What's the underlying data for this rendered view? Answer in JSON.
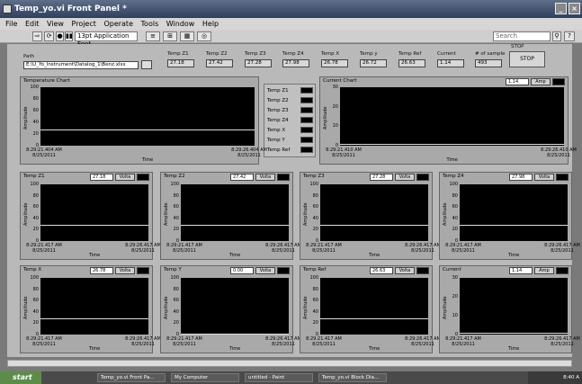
{
  "window": {
    "title": "Temp_yo.vi Front Panel *"
  },
  "menu": [
    "File",
    "Edit",
    "View",
    "Project",
    "Operate",
    "Tools",
    "Window",
    "Help"
  ],
  "toolbar": {
    "font": "13pt Application Font",
    "search_placeholder": "Search"
  },
  "path": {
    "label": "Path",
    "value": "E:\\U_Yo_Instrument\\Datalog_1\\Benz.xlsx"
  },
  "indicators": [
    {
      "label": "Temp Z1",
      "value": "27.18"
    },
    {
      "label": "Temp Z2",
      "value": "27.42"
    },
    {
      "label": "Temp Z3",
      "value": "27.28"
    },
    {
      "label": "Temp Z4",
      "value": "27.98"
    },
    {
      "label": "Temp X",
      "value": "26.78"
    },
    {
      "label": "Temp y",
      "value": "26.72"
    },
    {
      "label": "Temp Ref",
      "value": "26.63"
    },
    {
      "label": "Current",
      "value": "1.14"
    },
    {
      "label": "# of sample",
      "value": "493"
    }
  ],
  "stop": {
    "caption": "STOP",
    "label": "STOP"
  },
  "legend": [
    "Temp Z1",
    "Temp Z2",
    "Temp Z3",
    "Temp Z4",
    "Temp X",
    "Temp Y",
    "Temp Ref"
  ],
  "big_charts": [
    {
      "title": "Temperature Chart",
      "ylabel": "Amplitude",
      "yticks": [
        "100",
        "80",
        "60",
        "40",
        "20",
        "0"
      ],
      "x0": "8:29:21.404 AM",
      "x1": "8:29:26.404 AM",
      "date": "8/25/2011",
      "xlabel": "Time"
    },
    {
      "title": "Current Chart",
      "ylabel": "Amplitude",
      "yticks": [
        "30",
        "20",
        "10",
        "0"
      ],
      "x0": "8:29:21.410 AM",
      "x1": "8:29:26.410 AM",
      "date": "8/25/2011",
      "xlabel": "Time",
      "digital": "1.14",
      "unit": "Amp"
    }
  ],
  "small_charts": [
    {
      "title": "Temp Z1",
      "digital": "27.18",
      "unit": "Volta",
      "yticks": [
        "100",
        "80",
        "60",
        "40",
        "20",
        "0"
      ],
      "ylabel": "Amplitude",
      "x0": "8:29:21.417 AM",
      "x1": "8:29:26.417 AM",
      "date": "8/25/2011",
      "xlabel": "Time"
    },
    {
      "title": "Temp Z2",
      "digital": "27.42",
      "unit": "Volta",
      "yticks": [
        "100",
        "80",
        "60",
        "40",
        "20",
        "0"
      ],
      "ylabel": "Amplitude",
      "x0": "8:29:21.417 AM",
      "x1": "8:29:26.417 AM",
      "date": "8/25/2011",
      "xlabel": "Time"
    },
    {
      "title": "Temp Z3",
      "digital": "27.28",
      "unit": "Volta",
      "yticks": [
        "100",
        "80",
        "60",
        "40",
        "20",
        "0"
      ],
      "ylabel": "Amplitude",
      "x0": "8:29:21.417 AM",
      "x1": "8:29:26.417 AM",
      "date": "8/25/2011",
      "xlabel": "Time"
    },
    {
      "title": "Temp Z4",
      "digital": "27.98",
      "unit": "Volta",
      "yticks": [
        "100",
        "80",
        "60",
        "40",
        "20",
        "0"
      ],
      "ylabel": "Amplitude",
      "x0": "8:29:21.417 AM",
      "x1": "8:29:26.417 AM",
      "date": "8/25/2011",
      "xlabel": "Time"
    },
    {
      "title": "Temp X",
      "digital": "26.78",
      "unit": "Volta",
      "yticks": [
        "100",
        "80",
        "60",
        "40",
        "20",
        "0"
      ],
      "ylabel": "Amplitude",
      "x0": "8:29:21.417 AM",
      "x1": "8:29:26.417 AM",
      "date": "8/25/2011",
      "xlabel": "Time"
    },
    {
      "title": "Temp Y",
      "digital": "0.00",
      "unit": "Volta",
      "yticks": [
        "100",
        "80",
        "60",
        "40",
        "20",
        "0"
      ],
      "ylabel": "Amplitude",
      "x0": "8:29:21.417 AM",
      "x1": "8:29:26.417 AM",
      "date": "8/25/2011",
      "xlabel": "Time"
    },
    {
      "title": "Temp Ref",
      "digital": "26.63",
      "unit": "Volta",
      "yticks": [
        "100",
        "80",
        "60",
        "40",
        "20",
        "0"
      ],
      "ylabel": "Amplitude",
      "x0": "8:29:21.417 AM",
      "x1": "8:29:26.417 AM",
      "date": "8/25/2011",
      "xlabel": "Time"
    },
    {
      "title": "Current",
      "digital": "1.14",
      "unit": "Amp",
      "yticks": [
        "30",
        "20",
        "10",
        "0"
      ],
      "ylabel": "Amplitude",
      "x0": "8:29:21.417 AM",
      "x1": "8:29:26.417 AM",
      "date": "8/25/2011",
      "xlabel": "Time"
    }
  ],
  "taskbar": {
    "start": "start",
    "tasks": [
      "Temp_yo.vi Front Pa...",
      "My Computer",
      "untitled - Paint",
      "Temp_yo.vi Block Dia..."
    ],
    "clock": "8:40 A"
  }
}
